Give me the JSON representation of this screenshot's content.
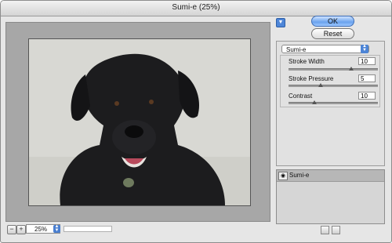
{
  "window": {
    "title": "Sumi-e (25%)"
  },
  "buttons": {
    "ok": "OK",
    "reset": "Reset"
  },
  "filter": {
    "selected": "Sumi-e",
    "params": [
      {
        "label": "Stroke Width",
        "value": "10"
      },
      {
        "label": "Stroke Pressure",
        "value": "5"
      },
      {
        "label": "Contrast",
        "value": "10"
      }
    ],
    "param_levels": [
      0.7,
      0.36,
      0.29
    ]
  },
  "preview": {
    "zoom": "25%",
    "zoom_out": "−",
    "zoom_in": "+"
  },
  "layers": {
    "items": [
      {
        "name": "Sumi-e"
      }
    ]
  },
  "colors": {
    "ok_accent": "#6aa3ee",
    "menu_arrow": "#4c84d6"
  }
}
